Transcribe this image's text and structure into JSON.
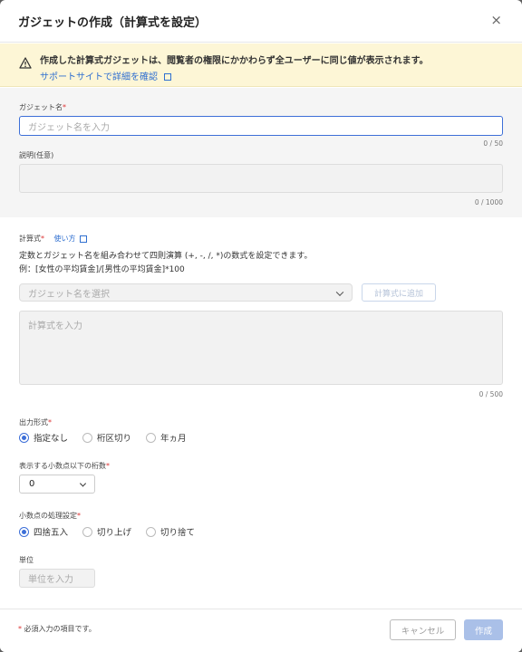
{
  "modal": {
    "title": "ガジェットの作成（計算式を設定）",
    "close_label": "×"
  },
  "notice": {
    "text": "作成した計算式ガジェットは、閲覧者の権限にかかわらず全ユーザーに同じ値が表示されます。",
    "link": "サポートサイトで詳細を確認"
  },
  "gadget_name": {
    "label": "ガジェット名",
    "required_mark": "*",
    "placeholder": "ガジェット名を入力",
    "counter": "0 / 50"
  },
  "description": {
    "label": "説明(任意)",
    "counter": "0 / 1000"
  },
  "formula": {
    "label": "計算式",
    "required_mark": "*",
    "help_link": "使い方",
    "desc_line1": "定数とガジェット名を組み合わせて四則演算 (+, -, /, *)の数式を設定できます。",
    "desc_line2": "例：[女性の平均賃金]/[男性の平均賃金]*100",
    "select_placeholder": "ガジェット名を選択",
    "add_button": "計算式に追加",
    "textarea_placeholder": "計算式を入力",
    "counter": "0 / 500"
  },
  "output_format": {
    "label": "出力形式",
    "required_mark": "*",
    "options": [
      "指定なし",
      "桁区切り",
      "年ヵ月"
    ],
    "selected": "指定なし"
  },
  "decimal_digits": {
    "label": "表示する小数点以下の桁数",
    "required_mark": "*",
    "value": "0"
  },
  "rounding": {
    "label": "小数点の処理設定",
    "required_mark": "*",
    "options": [
      "四捨五入",
      "切り上げ",
      "切り捨て"
    ],
    "selected": "四捨五入"
  },
  "unit": {
    "label": "単位",
    "placeholder": "単位を入力"
  },
  "footer": {
    "required_mark": "*",
    "note": "必須入力の項目です。",
    "cancel": "キャンセル",
    "create": "作成"
  },
  "colors": {
    "accent": "#3d6fd8",
    "notice_bg": "#fdf6d6",
    "required": "#d33333"
  }
}
